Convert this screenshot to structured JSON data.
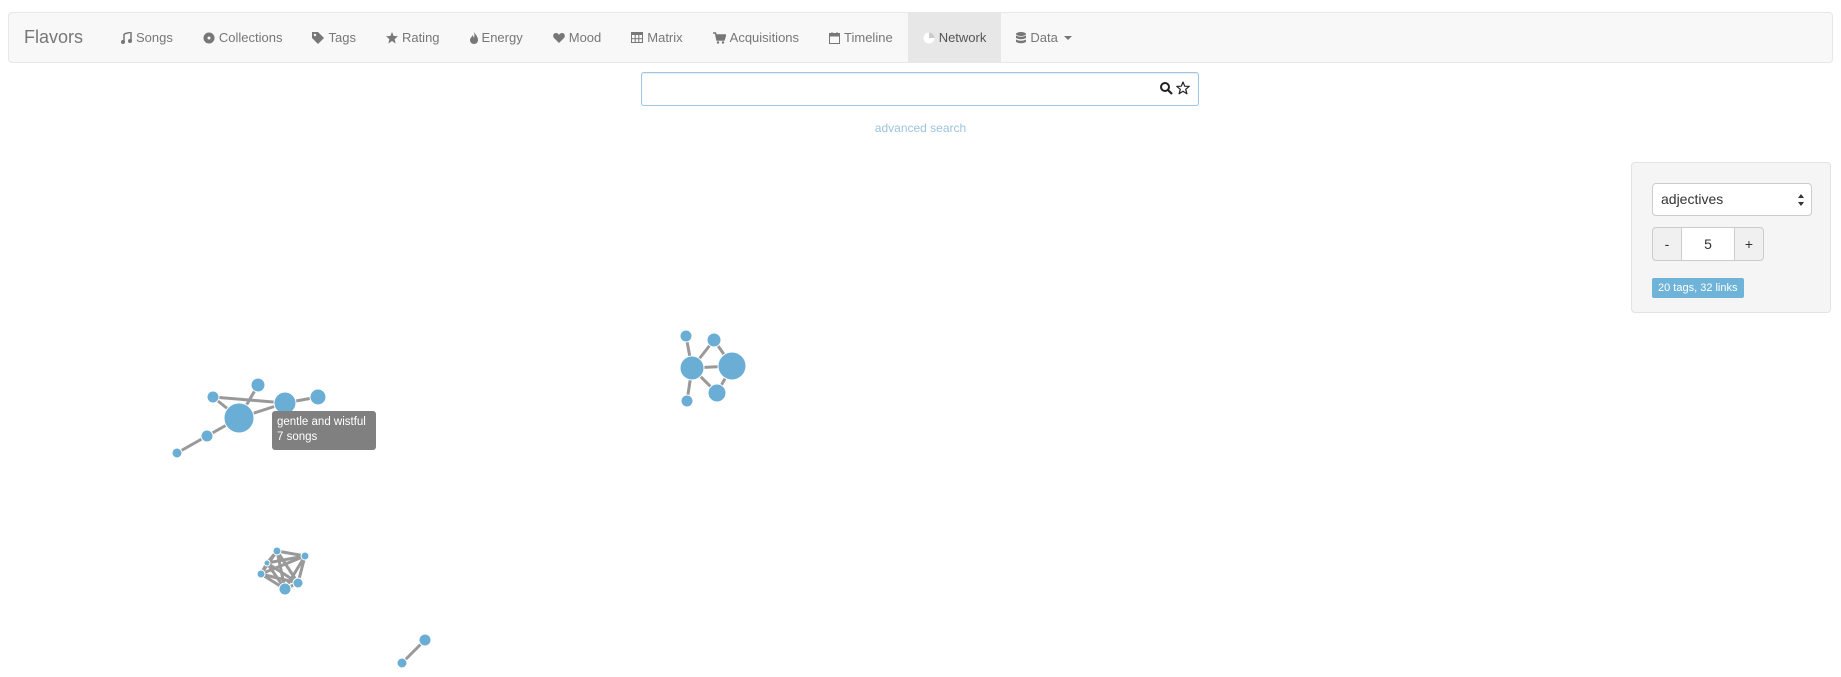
{
  "navbar": {
    "brand": "Flavors",
    "items": [
      {
        "label": "Songs",
        "icon": "music-icon"
      },
      {
        "label": "Collections",
        "icon": "record-icon"
      },
      {
        "label": "Tags",
        "icon": "tag-icon"
      },
      {
        "label": "Rating",
        "icon": "star-icon"
      },
      {
        "label": "Energy",
        "icon": "fire-icon"
      },
      {
        "label": "Mood",
        "icon": "heart-icon"
      },
      {
        "label": "Matrix",
        "icon": "table-icon"
      },
      {
        "label": "Acquisitions",
        "icon": "cart-icon"
      },
      {
        "label": "Timeline",
        "icon": "calendar-icon"
      },
      {
        "label": "Network",
        "icon": "network-icon",
        "active": true
      },
      {
        "label": "Data",
        "icon": "database-icon",
        "dropdown": true
      }
    ]
  },
  "search": {
    "value": "",
    "placeholder": "",
    "advanced_label": "advanced search"
  },
  "controls": {
    "category": "adjectives",
    "decrement_label": "-",
    "increment_label": "+",
    "strength": "5",
    "summary": "20 tags, 32 links"
  },
  "tooltip": {
    "title": "gentle and wistful",
    "detail": "7 songs"
  },
  "colors": {
    "node": "#6aaed6",
    "link": "#999999",
    "badge": "#6fb3d9"
  }
}
